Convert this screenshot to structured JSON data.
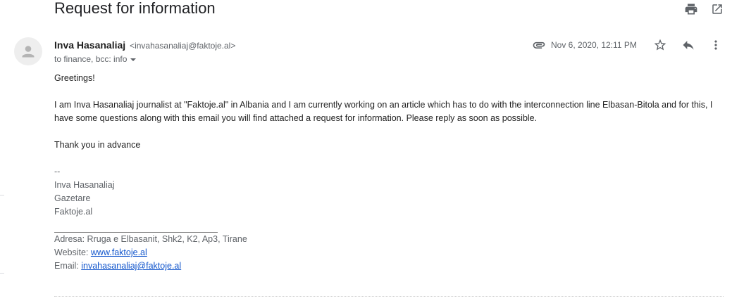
{
  "subject": "Request for information",
  "toolbar": {
    "print_icon": "print-icon",
    "open_new_window_icon": "open-in-new-icon"
  },
  "message": {
    "sender_name": "Inva Hasanaliaj",
    "sender_email": "<invahasanaliaj@faktoje.al>",
    "recipients": "to finance, bcc: info",
    "date": "Nov 6, 2020, 12:11 PM",
    "attachment_icon": "attachment-icon",
    "star_icon": "star-icon",
    "reply_icon": "reply-icon",
    "more_icon": "more-vert-icon"
  },
  "body": {
    "greeting": "Greetings!",
    "paragraph": "I am Inva Hasanaliaj journalist at \"Faktoje.al\" in Albania and I am currently working on an article which has to do with the interconnection line Elbasan-Bitola and for this, I have some questions along with this email you will find attached a request for information. Please reply as soon as possible.",
    "thanks": "Thank you in advance"
  },
  "signature": {
    "separator": "--",
    "name": "Inva Hasanaliaj",
    "role": "Gazetare",
    "org": "Faktoje.al",
    "address": "Adresa: Rruga e Elbasanit, Shk2, K2, Ap3, Tirane",
    "website_label": "Website:",
    "website_link": "www.faktoje.al",
    "email_label": "Email:",
    "email_link": "invahasanaliaj@faktoje.al"
  },
  "colors": {
    "link": "#1155cc",
    "secondary_text": "#5f6368",
    "icon": "#5f6368"
  }
}
